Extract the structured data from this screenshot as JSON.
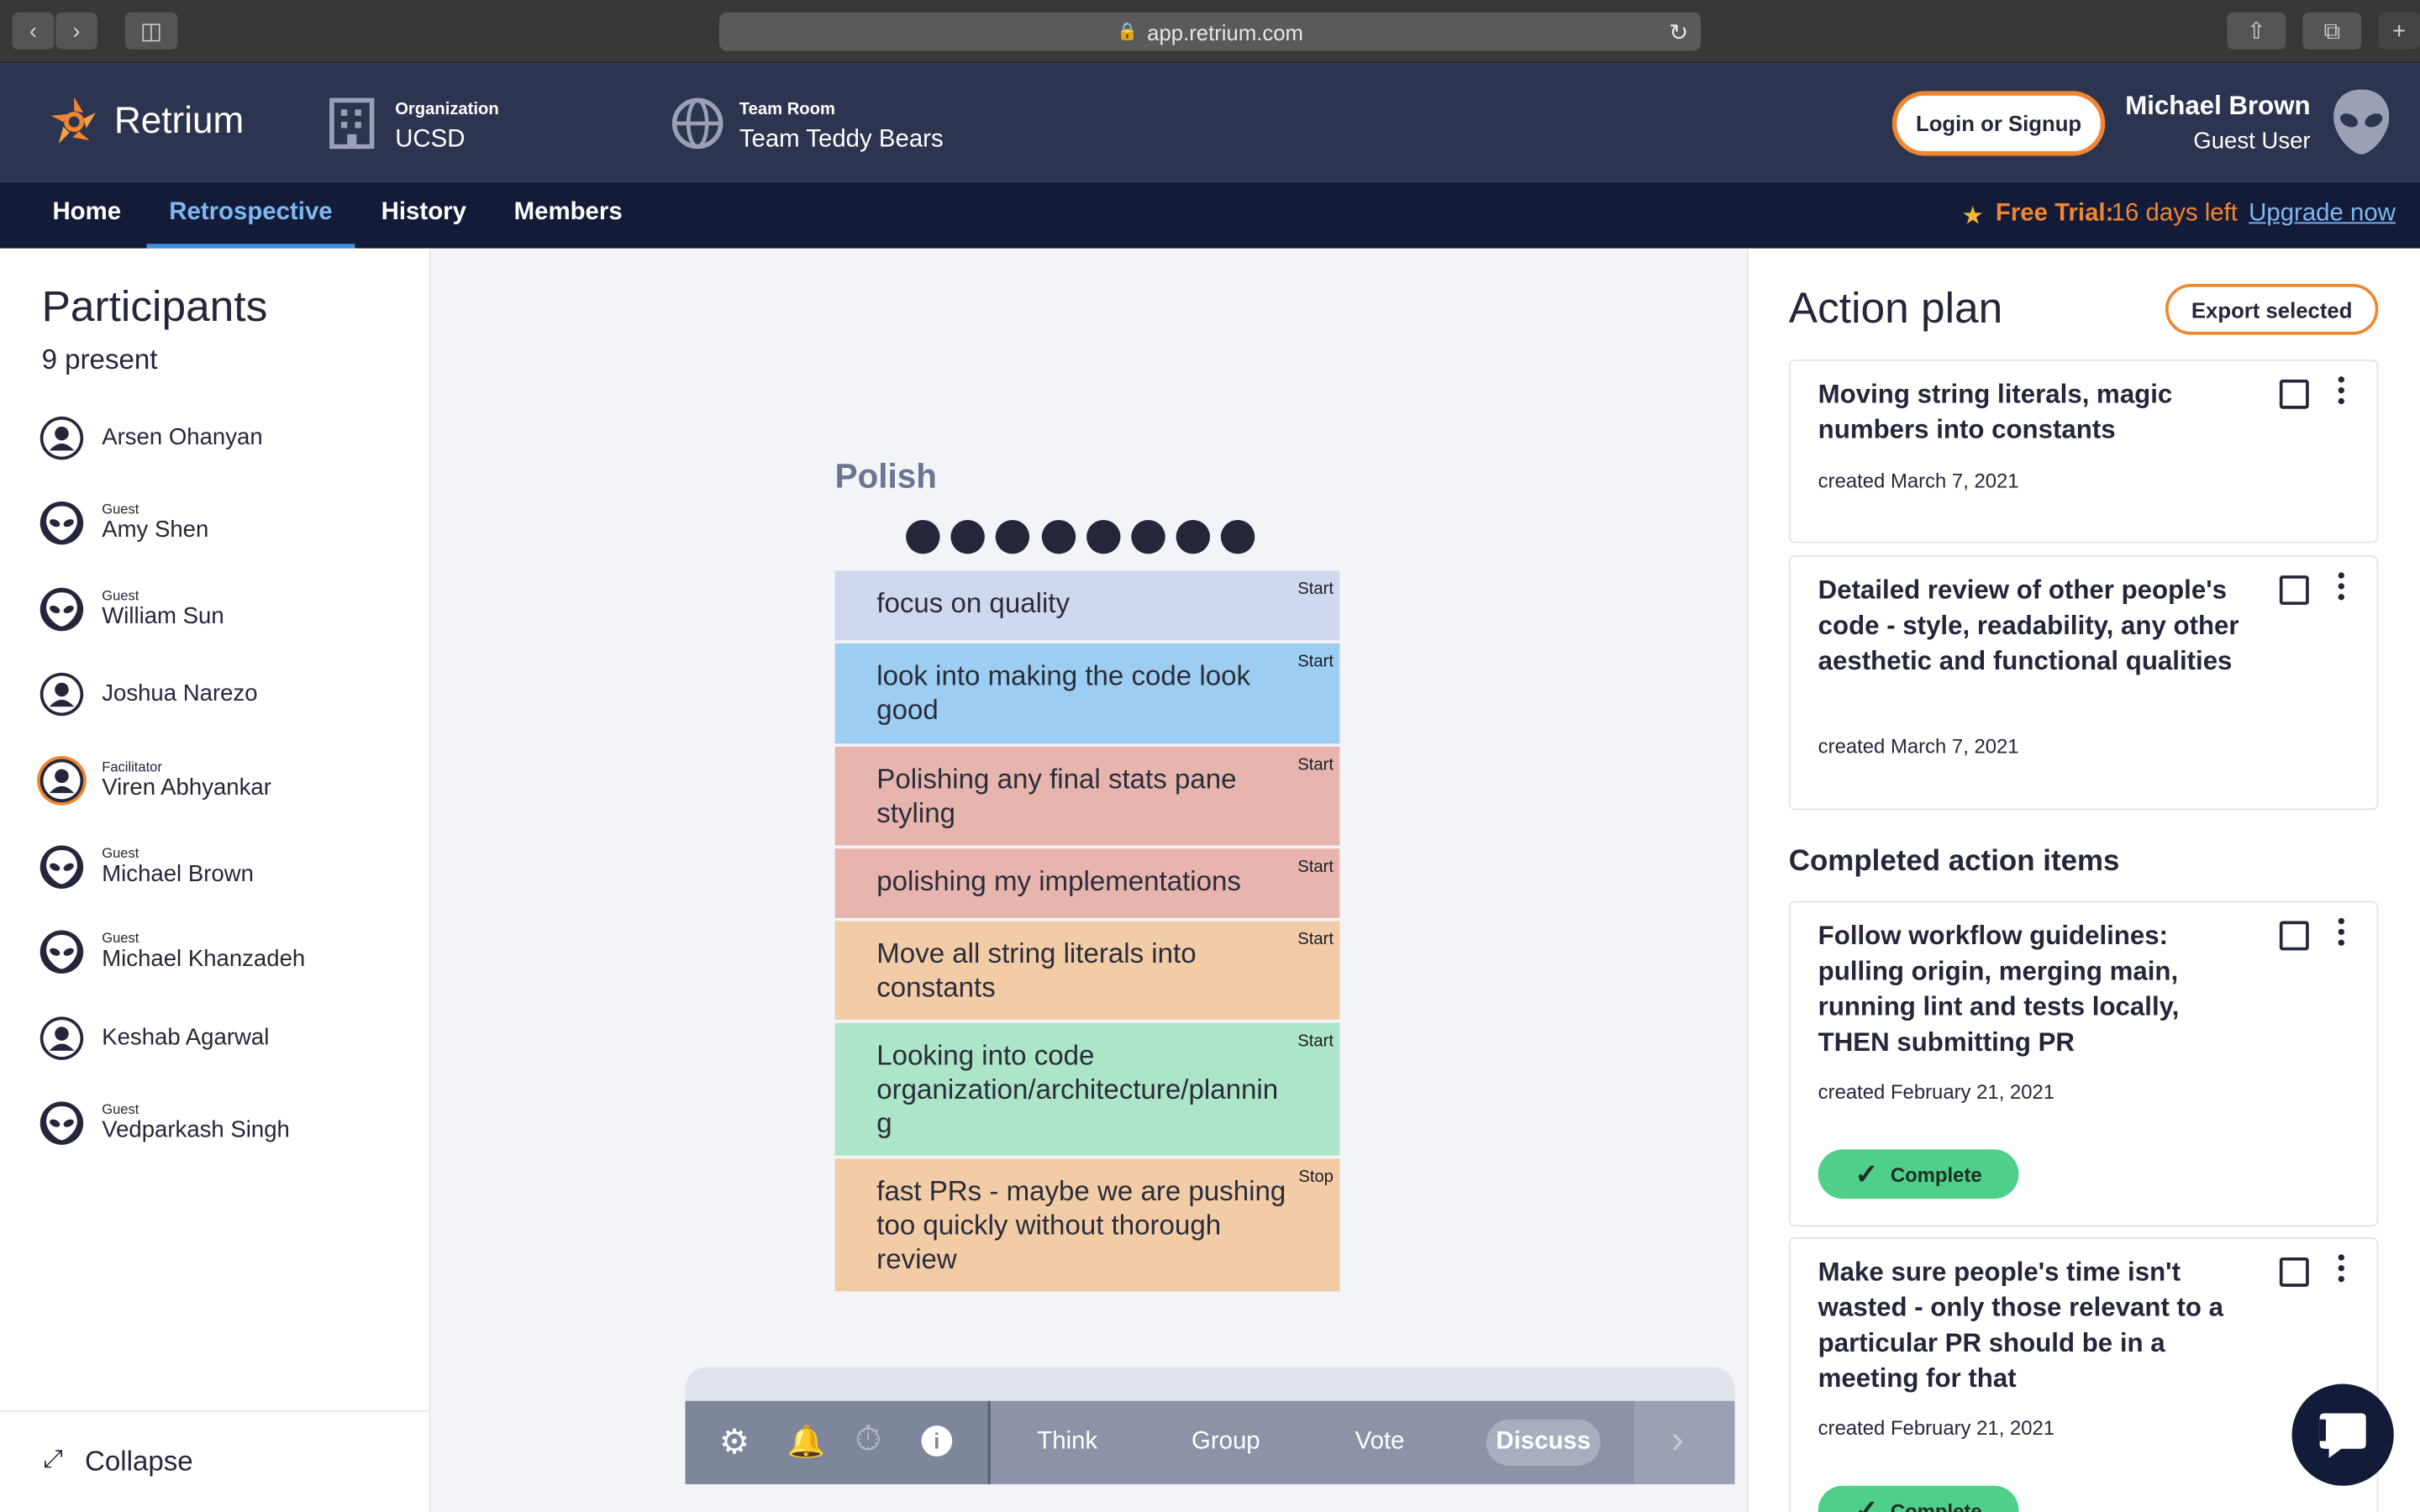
{
  "browser": {
    "url": "app.retrium.com"
  },
  "header": {
    "brand": "Retrium",
    "org_label": "Organization",
    "org_name": "UCSD",
    "room_label": "Team Room",
    "room_name": "Team Teddy Bears",
    "login_button": "Login or Signup",
    "user_name": "Michael Brown",
    "user_role": "Guest User"
  },
  "nav": {
    "tabs": [
      {
        "label": "Home"
      },
      {
        "label": "Retrospective",
        "active": true
      },
      {
        "label": "History"
      },
      {
        "label": "Members"
      }
    ],
    "trial_label": "Free Trial:",
    "trial_days": "16 days left",
    "upgrade_link": "Upgrade now"
  },
  "participants": {
    "title": "Participants",
    "count": "9 present",
    "list": [
      {
        "tag": "",
        "name": "Arsen Ohanyan",
        "avatar": "user-icon"
      },
      {
        "tag": "Guest",
        "name": "Amy Shen",
        "avatar": "alien-icon"
      },
      {
        "tag": "Guest",
        "name": "William Sun",
        "avatar": "alien-icon"
      },
      {
        "tag": "",
        "name": "Joshua Narezo",
        "avatar": "user-icon"
      },
      {
        "tag": "Facilitator",
        "name": "Viren Abhyankar",
        "avatar": "user-icon"
      },
      {
        "tag": "Guest",
        "name": "Michael Brown",
        "avatar": "alien-icon"
      },
      {
        "tag": "Guest",
        "name": "Michael Khanzadeh",
        "avatar": "alien-icon"
      },
      {
        "tag": "",
        "name": "Keshab Agarwal",
        "avatar": "user-icon"
      },
      {
        "tag": "Guest",
        "name": "Vedparkash Singh",
        "avatar": "alien-icon"
      }
    ],
    "collapse": "Collapse"
  },
  "group": {
    "title": "Polish",
    "votes": 8,
    "cards": [
      {
        "text": "focus on quality",
        "tag": "Start",
        "color": "#cfd8ee"
      },
      {
        "text": "look into making the code look good",
        "tag": "Start",
        "color": "#9ccdf2"
      },
      {
        "text": "Polishing any final stats pane styling",
        "tag": "Start",
        "color": "#e7b5ae"
      },
      {
        "text": "polishing my implementations",
        "tag": "Start",
        "color": "#e7b5ae"
      },
      {
        "text": "Move all string literals into constants",
        "tag": "Start",
        "color": "#f2cba7"
      },
      {
        "text": "Looking into code organization/architecture/plannin g",
        "tag": "Start",
        "color": "#ace5c7"
      },
      {
        "text": "fast PRs - maybe we are pushing too quickly without thorough review",
        "tag": "Stop",
        "color": "#f2cba7"
      }
    ]
  },
  "toolbar": {
    "phases": [
      "Think",
      "Group",
      "Vote",
      "Discuss"
    ],
    "active_phase": "Discuss"
  },
  "action_plan": {
    "title": "Action plan",
    "export_button": "Export selected",
    "items": [
      {
        "text": "Moving string literals, magic numbers into constants",
        "date": "created March 7, 2021"
      },
      {
        "text": "Detailed review of other people's code - style, readability, any other aesthetic and functional qualities",
        "date": "created March 7, 2021"
      }
    ],
    "completed_title": "Completed action items",
    "completed": [
      {
        "text": "Follow workflow guidelines: pulling origin, merging main, running lint and tests locally, THEN submitting PR",
        "date": "created February 21, 2021",
        "status": "Complete"
      },
      {
        "text": "Make sure people's time isn't wasted - only those relevant to a particular PR should be in a meeting for that",
        "date": "created February 21, 2021",
        "status": "Complete"
      }
    ]
  },
  "colors": {
    "header": "#2d3450",
    "nav": "#131b38",
    "accent": "#f0862f",
    "active_tab": "#7db8f0",
    "complete": "#4fd08a"
  }
}
